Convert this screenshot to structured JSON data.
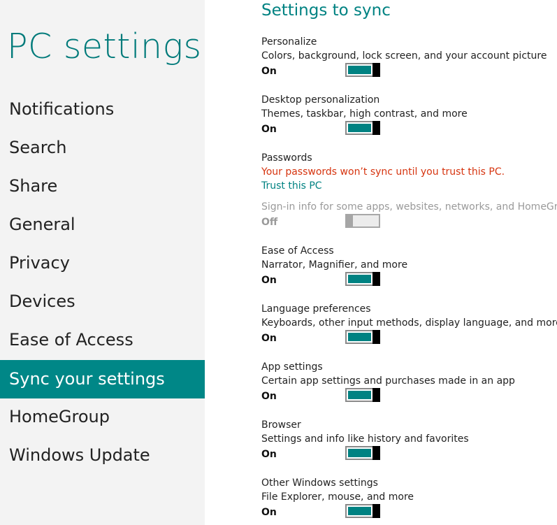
{
  "sidebar": {
    "title": "PC settings",
    "items": [
      {
        "label": "Notifications",
        "selected": false
      },
      {
        "label": "Search",
        "selected": false
      },
      {
        "label": "Share",
        "selected": false
      },
      {
        "label": "General",
        "selected": false
      },
      {
        "label": "Privacy",
        "selected": false
      },
      {
        "label": "Devices",
        "selected": false
      },
      {
        "label": "Ease of Access",
        "selected": false
      },
      {
        "label": "Sync your settings",
        "selected": true
      },
      {
        "label": "HomeGroup",
        "selected": false
      },
      {
        "label": "Windows Update",
        "selected": false
      }
    ]
  },
  "main": {
    "section_title": "Settings to sync",
    "settings": [
      {
        "name": "Personalize",
        "desc": "Colors, background, lock screen, and your account picture",
        "state": "On"
      },
      {
        "name": "Desktop personalization",
        "desc": "Themes, taskbar, high contrast, and more",
        "state": "On"
      },
      {
        "name": "Passwords",
        "warning": "Your passwords won’t sync until you trust this PC.",
        "link": "Trust this PC",
        "desc": "Sign-in info for some apps, websites, networks, and HomeGroup",
        "state": "Off"
      },
      {
        "name": "Ease of Access",
        "desc": "Narrator, Magnifier, and more",
        "state": "On"
      },
      {
        "name": "Language preferences",
        "desc": "Keyboards, other input methods, display language, and more",
        "state": "On"
      },
      {
        "name": "App settings",
        "desc": "Certain app settings and purchases made in an app",
        "state": "On"
      },
      {
        "name": "Browser",
        "desc": "Settings and info like history and favorites",
        "state": "On"
      },
      {
        "name": "Other Windows settings",
        "desc": "File Explorer, mouse, and more",
        "state": "On"
      }
    ]
  },
  "colors": {
    "accent": "#008282",
    "selected_bg": "#008787",
    "sidebar_bg": "#f3f3f3",
    "warning": "#d6340f"
  }
}
